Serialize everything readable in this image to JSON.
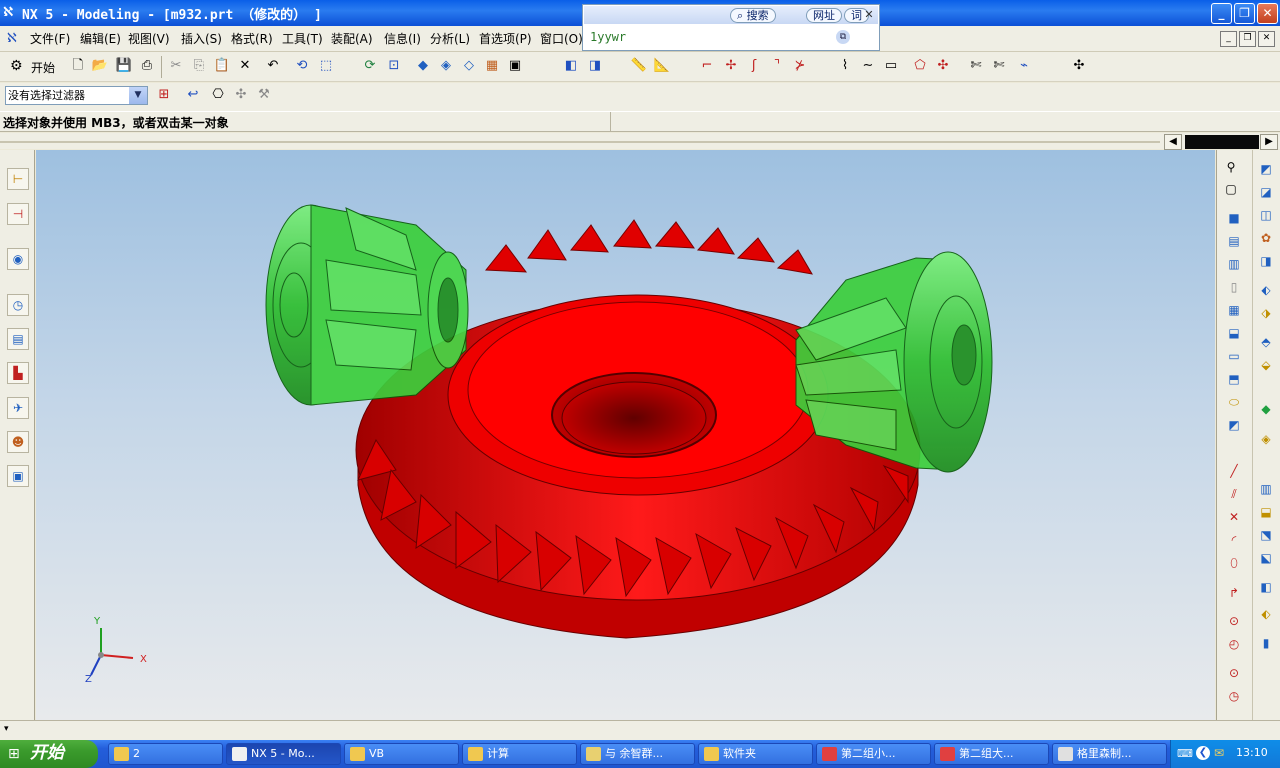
{
  "window": {
    "title": "NX 5 - Modeling - [m932.prt （修改的） ]",
    "app_icon": "nx-logo-icon",
    "controls": [
      "minimize-icon",
      "maximize-icon",
      "close-icon"
    ]
  },
  "menu": {
    "items": [
      "文件(F)",
      "编辑(E)",
      "视图(V)",
      "插入(S)",
      "格式(R)",
      "工具(T)",
      "装配(A)",
      "信息(I)",
      "分析(L)",
      "首选项(P)",
      "窗口(O)"
    ]
  },
  "search_popup": {
    "search_label": "搜索",
    "url_label": "网址",
    "word_label": "词",
    "input_value": "1yywr"
  },
  "toolbar": {
    "start_label": "开始"
  },
  "selection": {
    "filter_value": "没有选择过滤器"
  },
  "status": {
    "prompt": "选择对象并使用 MB3，或者双击某一对象"
  },
  "viewport": {
    "triad": {
      "x": "X",
      "y": "Y",
      "z": "Z"
    },
    "colors": {
      "ring_gear": "#e00000",
      "pinion": "#33cc33",
      "background_top": "#9ec0e0",
      "background_bottom": "#e8eaec"
    }
  },
  "taskbar": {
    "start_label": "开始",
    "tasks": [
      "2",
      "NX 5 - Mo...",
      "VB",
      "计算",
      "与 余智群...",
      "软件夹",
      "第二组小...",
      "第二组大...",
      "格里森制..."
    ],
    "clock": "13:10"
  }
}
